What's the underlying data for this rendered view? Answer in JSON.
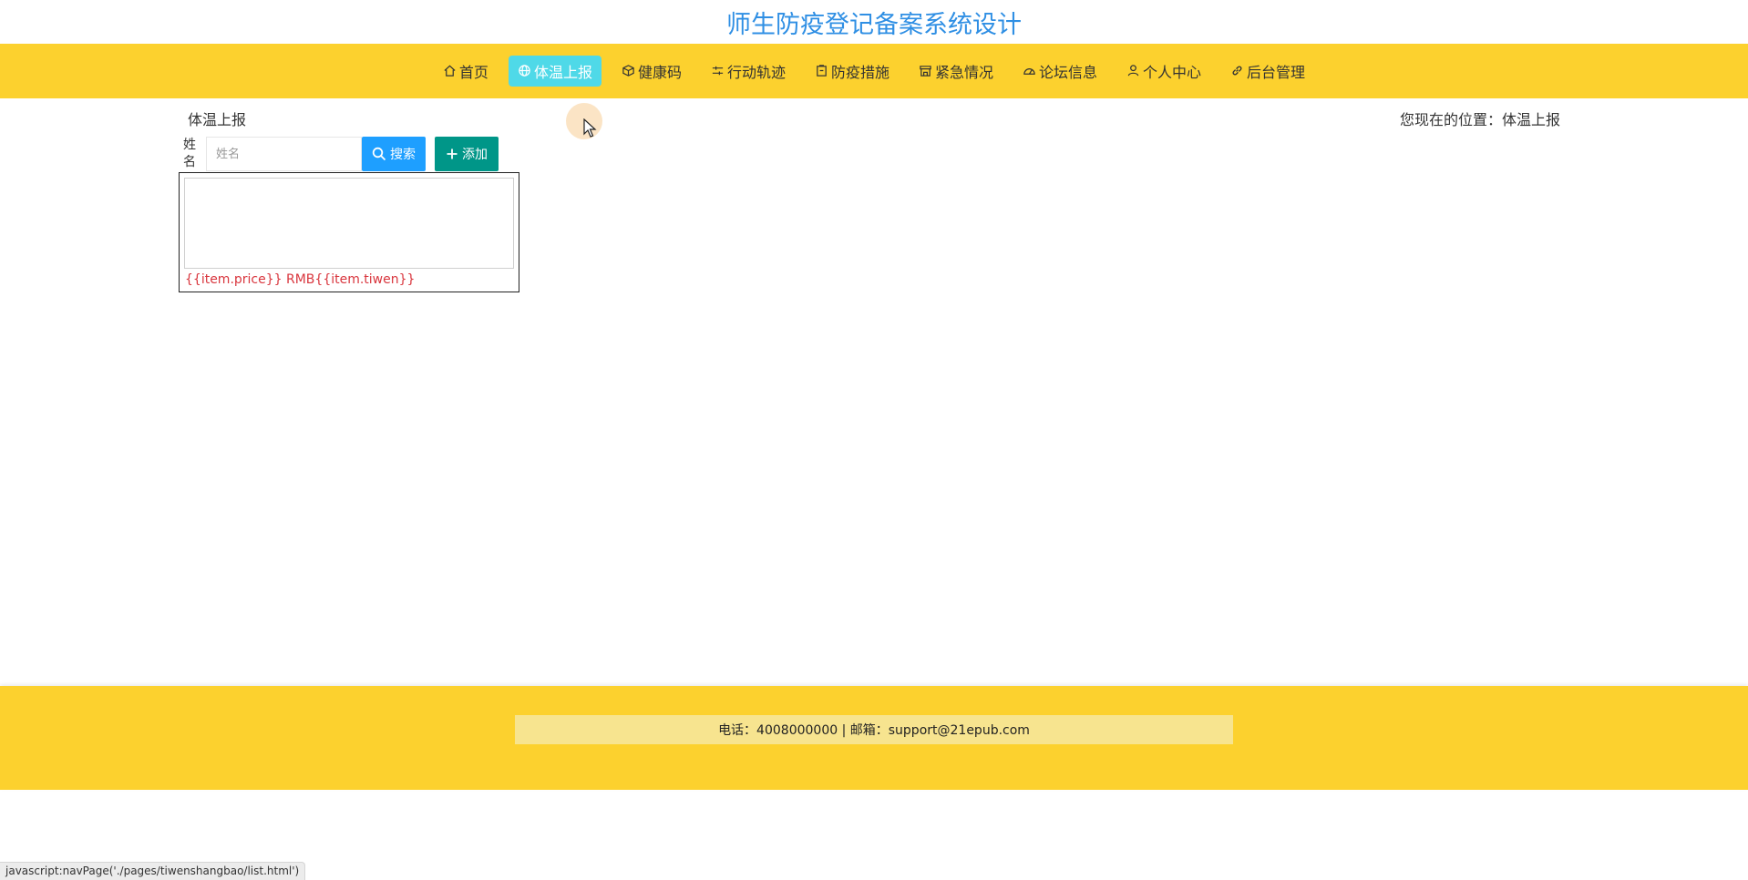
{
  "site": {
    "title": "师生防疫登记备案系统设计"
  },
  "nav": {
    "items": [
      {
        "label": "首页",
        "icon": "home-icon",
        "active": false
      },
      {
        "label": "体温上报",
        "icon": "globe-icon",
        "active": true
      },
      {
        "label": "健康码",
        "icon": "cube-icon",
        "active": false
      },
      {
        "label": "行动轨迹",
        "icon": "sliders-icon",
        "active": false
      },
      {
        "label": "防疫措施",
        "icon": "clipboard-icon",
        "active": false
      },
      {
        "label": "紧急情况",
        "icon": "shop-icon",
        "active": false
      },
      {
        "label": "论坛信息",
        "icon": "gauge-icon",
        "active": false
      },
      {
        "label": "个人中心",
        "icon": "user-icon",
        "active": false
      },
      {
        "label": "后台管理",
        "icon": "link-icon",
        "active": false
      }
    ]
  },
  "breadcrumb": {
    "current": "体温上报",
    "location": "您现在的位置：体温上报"
  },
  "search": {
    "label": "姓名",
    "placeholder": "姓名",
    "value": "",
    "search_button": "搜索",
    "add_button": "添加"
  },
  "list": {
    "items": [
      {
        "price_text": "{{item.price}} RMB{{item.tiwen}}"
      }
    ]
  },
  "footer": {
    "info": "电话：4008000000 | 邮箱：support@21epub.com"
  },
  "status_bar": {
    "text": "javascript:navPage('./pages/tiwenshangbao/list.html')"
  },
  "colors": {
    "title": "#2f8fe4",
    "nav_bg": "#fcd12e",
    "nav_active": "#4fd9e8",
    "search_button": "#1e9fff",
    "add_button": "#009688",
    "price_text": "#d9363e",
    "footer_info_bg": "#f7e48f"
  }
}
